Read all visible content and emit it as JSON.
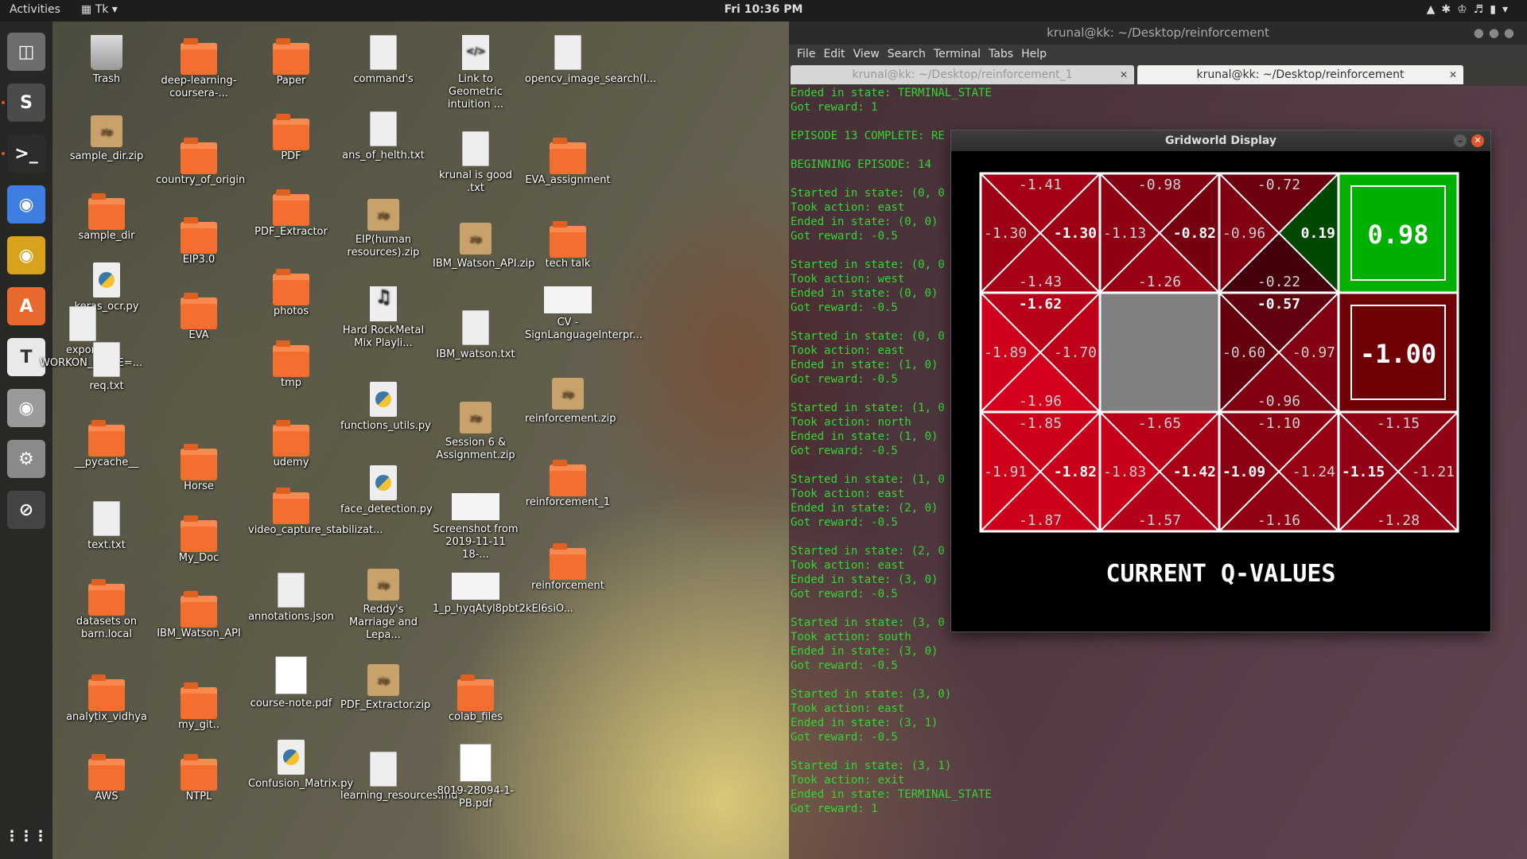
{
  "topbar": {
    "activities": "Activities",
    "app_menu": "Tk",
    "clock": "Fri 10:36 PM",
    "tray_icons": [
      "wifi-icon",
      "bluetooth-icon",
      "accessibility-icon",
      "volume-icon",
      "battery-icon",
      "power-menu-icon"
    ]
  },
  "dock": {
    "items": [
      "files-icon",
      "sublime-text-icon",
      "terminal-icon",
      "chrome-icon",
      "rhythmbox-icon",
      "software-center-icon",
      "text-editor-icon",
      "screenshot-icon",
      "settings-icon",
      "no-entry-icon"
    ]
  },
  "desktop": {
    "icons": [
      {
        "label": "Trash",
        "type": "trash"
      },
      {
        "label": "sample_dir.zip",
        "type": "zip"
      },
      {
        "label": "sample_dir",
        "type": "folder"
      },
      {
        "label": "keras_ocr.py",
        "type": "py"
      },
      {
        "label": "export WORKON_HOME=...",
        "type": "file"
      },
      {
        "label": "req.txt",
        "type": "file"
      },
      {
        "label": "__pycache__",
        "type": "folder"
      },
      {
        "label": "text.txt",
        "type": "file"
      },
      {
        "label": "datasets on barn.local",
        "type": "folder"
      },
      {
        "label": "analytix_vidhya",
        "type": "folder"
      },
      {
        "label": "AWS",
        "type": "folder"
      },
      {
        "label": "deep-learning-coursera-...",
        "type": "folder"
      },
      {
        "label": "country_of_origin",
        "type": "folder"
      },
      {
        "label": "EIP3.0",
        "type": "folder"
      },
      {
        "label": "EVA",
        "type": "folder"
      },
      {
        "label": "Horse",
        "type": "folder"
      },
      {
        "label": "My_Doc",
        "type": "folder"
      },
      {
        "label": "IBM_Watson_API",
        "type": "folder"
      },
      {
        "label": "my_git..",
        "type": "folder"
      },
      {
        "label": "NTPL",
        "type": "folder"
      },
      {
        "label": "Paper",
        "type": "folder"
      },
      {
        "label": "PDF",
        "type": "folder"
      },
      {
        "label": "PDF_Extractor",
        "type": "folder"
      },
      {
        "label": "photos",
        "type": "folder"
      },
      {
        "label": "tmp",
        "type": "folder"
      },
      {
        "label": "udemy",
        "type": "folder"
      },
      {
        "label": "video_capture_stabilizat...",
        "type": "folder"
      },
      {
        "label": "annotations.json",
        "type": "file"
      },
      {
        "label": "course-note.pdf",
        "type": "pdf"
      },
      {
        "label": "Confusion_Matrix.py",
        "type": "py"
      },
      {
        "label": "command's",
        "type": "file"
      },
      {
        "label": "ans_of_helth.txt",
        "type": "file"
      },
      {
        "label": "EIP(human resources).zip",
        "type": "zip"
      },
      {
        "label": "Hard RockMetal Mix Playli...",
        "type": "music"
      },
      {
        "label": "functions_utils.py",
        "type": "py"
      },
      {
        "label": "face_detection.py",
        "type": "py"
      },
      {
        "label": "Reddy's Marriage and Lepa...",
        "type": "zip"
      },
      {
        "label": "PDF_Extractor.zip",
        "type": "zip"
      },
      {
        "label": "learning_resources.md",
        "type": "file"
      },
      {
        "label": "Link to Geometric intuition ...",
        "type": "link"
      },
      {
        "label": "krunal is good .txt",
        "type": "file"
      },
      {
        "label": "IBM_Watson_API.zip",
        "type": "zip"
      },
      {
        "label": "IBM_watson.txt",
        "type": "file"
      },
      {
        "label": "Session 6 & Assignment.zip",
        "type": "zip"
      },
      {
        "label": "Screenshot from 2019-11-11 18-...",
        "type": "img"
      },
      {
        "label": "1_p_hyqAtyl8pbt2kEl6siO...",
        "type": "img"
      },
      {
        "label": "colab_files",
        "type": "folder"
      },
      {
        "label": "8019-28094-1-PB.pdf",
        "type": "pdf"
      },
      {
        "label": "opencv_image_search(I...",
        "type": "file"
      },
      {
        "label": "EVA_assignment",
        "type": "folder"
      },
      {
        "label": "tech talk",
        "type": "folder"
      },
      {
        "label": "CV - SignLanguageInterpr...",
        "type": "img"
      },
      {
        "label": "reinforcement.zip",
        "type": "zip"
      },
      {
        "label": "reinforcement_1",
        "type": "folder"
      },
      {
        "label": "reinforcement",
        "type": "folder"
      }
    ]
  },
  "terminal": {
    "title": "krunal@kk: ~/Desktop/reinforcement",
    "menu": [
      "File",
      "Edit",
      "View",
      "Search",
      "Terminal",
      "Tabs",
      "Help"
    ],
    "tabs": [
      {
        "label": "krunal@kk: ~/Desktop/reinforcement_1",
        "active": false
      },
      {
        "label": "krunal@kk: ~/Desktop/reinforcement",
        "active": true
      }
    ],
    "lines": [
      "Ended in state: TERMINAL_STATE",
      "Got reward: 1",
      "",
      "EPISODE 13 COMPLETE: RE",
      "",
      "BEGINNING EPISODE: 14",
      "",
      "Started in state: (0, 0",
      "Took action: east",
      "Ended in state: (0, 0)",
      "Got reward: -0.5",
      "",
      "Started in state: (0, 0",
      "Took action: west",
      "Ended in state: (0, 0)",
      "Got reward: -0.5",
      "",
      "Started in state: (0, 0",
      "Took action: east",
      "Ended in state: (1, 0)",
      "Got reward: -0.5",
      "",
      "Started in state: (1, 0",
      "Took action: north",
      "Ended in state: (1, 0)",
      "Got reward: -0.5",
      "",
      "Started in state: (1, 0",
      "Took action: east",
      "Ended in state: (2, 0)",
      "Got reward: -0.5",
      "",
      "Started in state: (2, 0",
      "Took action: east",
      "Ended in state: (3, 0)",
      "Got reward: -0.5",
      "",
      "Started in state: (3, 0",
      "Took action: south",
      "Ended in state: (3, 0)",
      "Got reward: -0.5",
      "",
      "Started in state: (3, 0)",
      "Took action: east",
      "Ended in state: (3, 1)",
      "Got reward: -0.5",
      "",
      "Started in state: (3, 1)",
      "Took action: exit",
      "Ended in state: TERMINAL_STATE",
      "Got reward: 1"
    ]
  },
  "gridworld": {
    "title": "Gridworld Display",
    "caption": "CURRENT Q-VALUES",
    "cells": [
      [
        {
          "kind": "q",
          "north": "-1.41",
          "west": "-1.30",
          "east": "-1.30",
          "south": "-1.43",
          "best": "east"
        },
        {
          "kind": "q",
          "north": "-0.98",
          "west": "-1.13",
          "east": "-0.82",
          "south": "-1.26",
          "best": "east"
        },
        {
          "kind": "q",
          "north": "-0.72",
          "west": "-0.96",
          "east": "0.19",
          "south": "-0.22",
          "best": "east"
        },
        {
          "kind": "terminal",
          "value": "0.98",
          "color": "#00b000"
        }
      ],
      [
        {
          "kind": "q",
          "north": "-1.62",
          "west": "-1.89",
          "east": "-1.70",
          "south": "-1.96",
          "best": "north"
        },
        {
          "kind": "wall"
        },
        {
          "kind": "q",
          "north": "-0.57",
          "west": "-0.60",
          "east": "-0.97",
          "south": "-0.96",
          "best": "north"
        },
        {
          "kind": "terminal",
          "value": "-1.00",
          "color": "#6e0006"
        }
      ],
      [
        {
          "kind": "q",
          "north": "-1.85",
          "west": "-1.91",
          "east": "-1.82",
          "south": "-1.87",
          "best": "east"
        },
        {
          "kind": "q",
          "north": "-1.65",
          "west": "-1.83",
          "east": "-1.42",
          "south": "-1.57",
          "best": "east"
        },
        {
          "kind": "q",
          "north": "-1.10",
          "west": "-1.09",
          "east": "-1.24",
          "south": "-1.16",
          "best": "west"
        },
        {
          "kind": "q",
          "north": "-1.15",
          "west": "-1.15",
          "east": "-1.21",
          "south": "-1.28",
          "best": "west"
        }
      ]
    ]
  }
}
